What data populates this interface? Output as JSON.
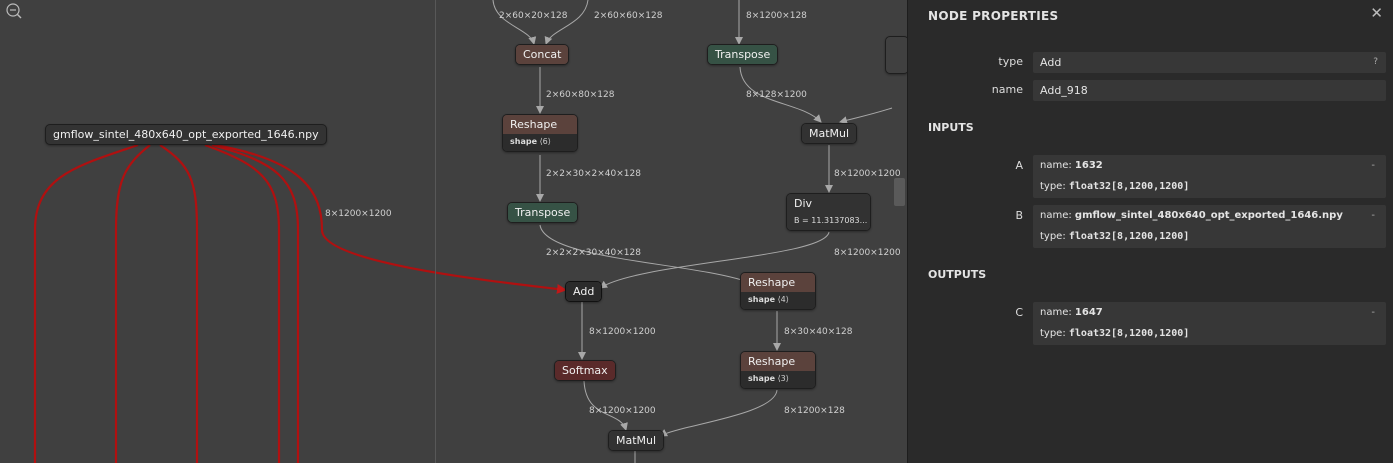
{
  "graph": {
    "input_node": "gmflow_sintel_480x640_opt_exported_1646.npy",
    "edge_labels": {
      "left_edge": "8×1200×1200",
      "concat_in_a": "2×60×20×128",
      "concat_in_b": "2×60×60×128",
      "transpose_top_in": "8×1200×128",
      "concat_out": "2×60×80×128",
      "reshape1_out": "2×2×30×2×40×128",
      "transpose1_out": "2×2×2×30×40×128",
      "transpose_top_out": "8×128×1200",
      "matmul_out": "8×1200×1200",
      "div_out": "8×1200×1200",
      "add_out": "8×1200×1200",
      "reshape2_out": "8×30×40×128",
      "softmax_out": "8×1200×1200",
      "reshape3_out": "8×1200×128"
    },
    "nodes": {
      "concat": "Concat",
      "transpose_top": "Transpose",
      "reshape1": {
        "title": "Reshape",
        "attr_key": "shape",
        "attr_val": "⟨6⟩"
      },
      "matmul_top": "MatMul",
      "div": {
        "title": "Div",
        "attr": "B = 11.3137083..."
      },
      "transpose_mid": "Transpose",
      "add": "Add",
      "reshape2": {
        "title": "Reshape",
        "attr_key": "shape",
        "attr_val": "⟨4⟩"
      },
      "softmax": "Softmax",
      "reshape3": {
        "title": "Reshape",
        "attr_key": "shape",
        "attr_val": "⟨3⟩"
      },
      "matmul_bottom": "MatMul"
    }
  },
  "panel": {
    "title": "NODE PROPERTIES",
    "close": "✕",
    "type_key": "type",
    "type_val": "Add",
    "type_help": "?",
    "name_key": "name",
    "name_val": "Add_918",
    "inputs_heading": "INPUTS",
    "outputs_heading": "OUTPUTS",
    "inputs": [
      {
        "key": "A",
        "name_label": "name: ",
        "name": "1632",
        "type_label": "type: ",
        "type": "float32[8,1200,1200]",
        "dash": "-"
      },
      {
        "key": "B",
        "name_label": "name: ",
        "name": "gmflow_sintel_480x640_opt_exported_1646.npy",
        "type_label": "type: ",
        "type": "float32[8,1200,1200]",
        "dash": "-"
      }
    ],
    "outputs": [
      {
        "key": "C",
        "name_label": "name: ",
        "name": "1647",
        "type_label": "type: ",
        "type": "float32[8,1200,1200]",
        "dash": "-"
      }
    ]
  },
  "colors": {
    "highlight_edge": "#b01010",
    "edge": "#a8a8a8",
    "background": "#404040",
    "panel": "#2a2a2a"
  }
}
